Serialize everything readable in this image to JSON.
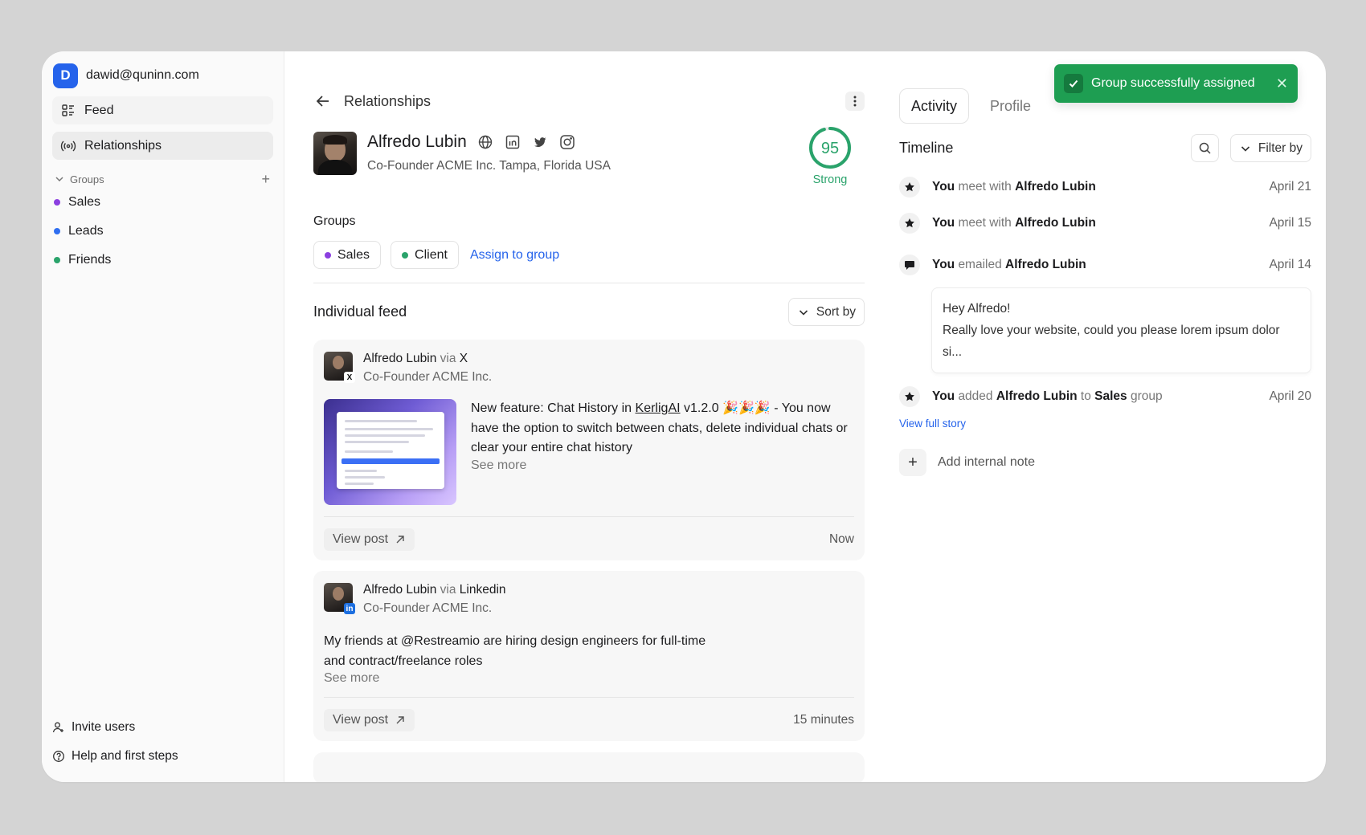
{
  "account": {
    "initial": "D",
    "email": "dawid@quninn.com"
  },
  "sidebar": {
    "nav": [
      {
        "label": "Feed",
        "icon": "feed-list-icon"
      },
      {
        "label": "Relationships",
        "icon": "broadcast-icon"
      }
    ],
    "groups_label": "Groups",
    "groups": [
      {
        "label": "Sales",
        "color": "#8b3fe0"
      },
      {
        "label": "Leads",
        "color": "#2f6ef0"
      },
      {
        "label": "Friends",
        "color": "#2aa36b"
      }
    ],
    "footer": [
      {
        "label": "Invite users",
        "icon": "user-plus-icon"
      },
      {
        "label": "Help and first steps",
        "icon": "help-circle-icon"
      }
    ]
  },
  "main": {
    "title": "Relationships",
    "profile": {
      "name": "Alfredo Lubin",
      "subtitle": "Co-Founder ACME Inc. Tampa, Florida USA",
      "score": "95",
      "score_label": "Strong",
      "score_fraction": 0.95,
      "score_color": "#2aa36b"
    },
    "groups_title": "Groups",
    "chips": [
      {
        "label": "Sales",
        "color": "#8b3fe0"
      },
      {
        "label": "Client",
        "color": "#2aa36b"
      }
    ],
    "assign_label": "Assign to group",
    "feed_title": "Individual feed",
    "sort_label": "Sort by",
    "posts": [
      {
        "author": "Alfredo Lubin",
        "via_word": "via",
        "source": "X",
        "subtitle": "Co-Founder ACME Inc.",
        "text_before": "New feature: Chat History in ",
        "link": "KerligAI",
        "text_after": " v1.2.0 🎉🎉🎉 - You now have the option to switch between chats, delete individual chats or clear your entire chat history",
        "see_more": "See more",
        "view_post": "View post",
        "time": "Now"
      },
      {
        "author": "Alfredo Lubin",
        "via_word": "via",
        "source": "Linkedin",
        "subtitle": "Co-Founder ACME Inc.",
        "text": "My friends at @Restreamio are hiring design engineers for full-time and contract/freelance roles",
        "see_more": "See more",
        "view_post": "View post",
        "time": "15 minutes"
      }
    ]
  },
  "right": {
    "tabs": [
      "Activity",
      "Profile"
    ],
    "timeline_title": "Timeline",
    "filter_label": "Filter by",
    "items": [
      {
        "actor": "You",
        "verb": "meet with",
        "target": "Alfredo Lubin",
        "date": "April 21",
        "icon": "star-icon"
      },
      {
        "actor": "You",
        "verb": "meet with",
        "target": "Alfredo Lubin",
        "date": "April 15",
        "icon": "star-icon"
      },
      {
        "actor": "You",
        "verb": "emailed",
        "target": "Alfredo Lubin",
        "date": "April 14",
        "icon": "message-icon"
      },
      {
        "actor": "You",
        "verb": "added",
        "target": "Alfredo Lubin",
        "verb2": "to",
        "target2": "Sales",
        "suffix": "group",
        "date": "April 20",
        "icon": "star-icon"
      }
    ],
    "email_lines": [
      "Hey Alfredo!",
      "Really love your website, could you please lorem ipsum dolor si..."
    ],
    "view_full": "View full story",
    "add_note": "Add internal note"
  },
  "toast": {
    "message": "Group successfully assigned",
    "color": "#1e9e52"
  }
}
